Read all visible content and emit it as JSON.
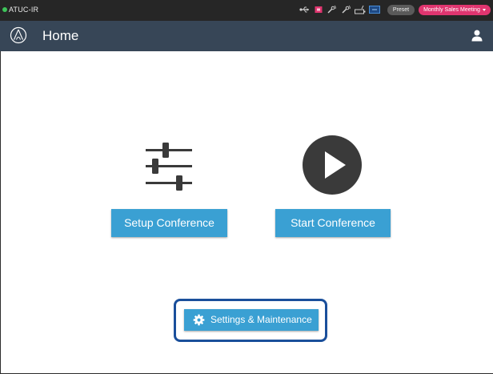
{
  "status_bar": {
    "device_name": "ATUC-IR",
    "preset_label": "Preset",
    "meeting_name": "Monthly Sales Meeting",
    "icons": [
      "usb-icon",
      "record-indicator-icon",
      "mic-signal-icon",
      "mic-signal-icon",
      "battery-icon",
      "network-icon"
    ],
    "colors": {
      "status_dot": "#3ec45a",
      "record": "#e0356f",
      "meeting_badge": "#e0356f"
    }
  },
  "header": {
    "title": "Home",
    "logo_icon": "audio-technica-logo",
    "user_icon": "user-icon",
    "background": "#374657"
  },
  "main": {
    "setup": {
      "icon": "sliders-icon",
      "label": "Setup Conference"
    },
    "start": {
      "icon": "play-circle-icon",
      "label": "Start Conference"
    },
    "settings": {
      "icon": "gear-icon",
      "label": "Settings & Maintenance"
    },
    "button_color": "#3aa0d3",
    "highlight_color": "#1a4f9b"
  }
}
